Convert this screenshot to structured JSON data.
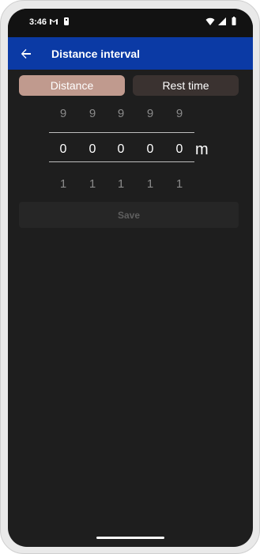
{
  "status_bar": {
    "time": "3:46",
    "left_icons": [
      "gmail-icon",
      "accessibility-icon"
    ],
    "right_icons": [
      "wifi-icon",
      "signal-icon",
      "battery-icon"
    ]
  },
  "app_bar": {
    "back_icon": "arrow-left-icon",
    "title": "Distance interval",
    "color": "#0b3aa5"
  },
  "tabs": [
    {
      "label": "Distance",
      "selected": true
    },
    {
      "label": "Rest time",
      "selected": false
    }
  ],
  "picker": {
    "previous_row": [
      "9",
      "9",
      "9",
      "9",
      "9"
    ],
    "current_row": [
      "0",
      "0",
      "0",
      "0",
      "0"
    ],
    "next_row": [
      "1",
      "1",
      "1",
      "1",
      "1"
    ],
    "unit": "m"
  },
  "save_button": {
    "label": "Save",
    "enabled": false
  },
  "colors": {
    "accent": "#c09a8e",
    "background": "#1e1e1e"
  }
}
